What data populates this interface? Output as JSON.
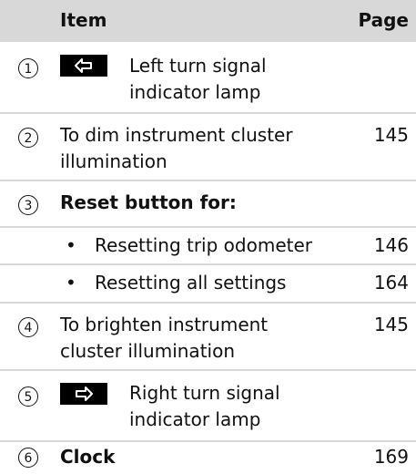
{
  "header": {
    "item": "Item",
    "page": "Page"
  },
  "rows": [
    {
      "num": "1",
      "label": "Left turn signal indicator lamp",
      "page": ""
    },
    {
      "num": "2",
      "label": "To dim instrument cluster illumination",
      "page": "145"
    },
    {
      "num": "3",
      "label": "Reset button for:",
      "page": ""
    },
    {
      "bullet": "•",
      "label": "Resetting trip odometer",
      "page": "146"
    },
    {
      "bullet": "•",
      "label": "Resetting all settings",
      "page": "164"
    },
    {
      "num": "4",
      "label": "To brighten instrument cluster illumination",
      "page": "145"
    },
    {
      "num": "5",
      "label": "Right turn signal indicator lamp",
      "page": ""
    },
    {
      "num": "6",
      "label": "Clock",
      "page": "169"
    }
  ],
  "icons": {
    "left_arrow": "left-turn-arrow-icon",
    "right_arrow": "right-turn-arrow-icon"
  }
}
